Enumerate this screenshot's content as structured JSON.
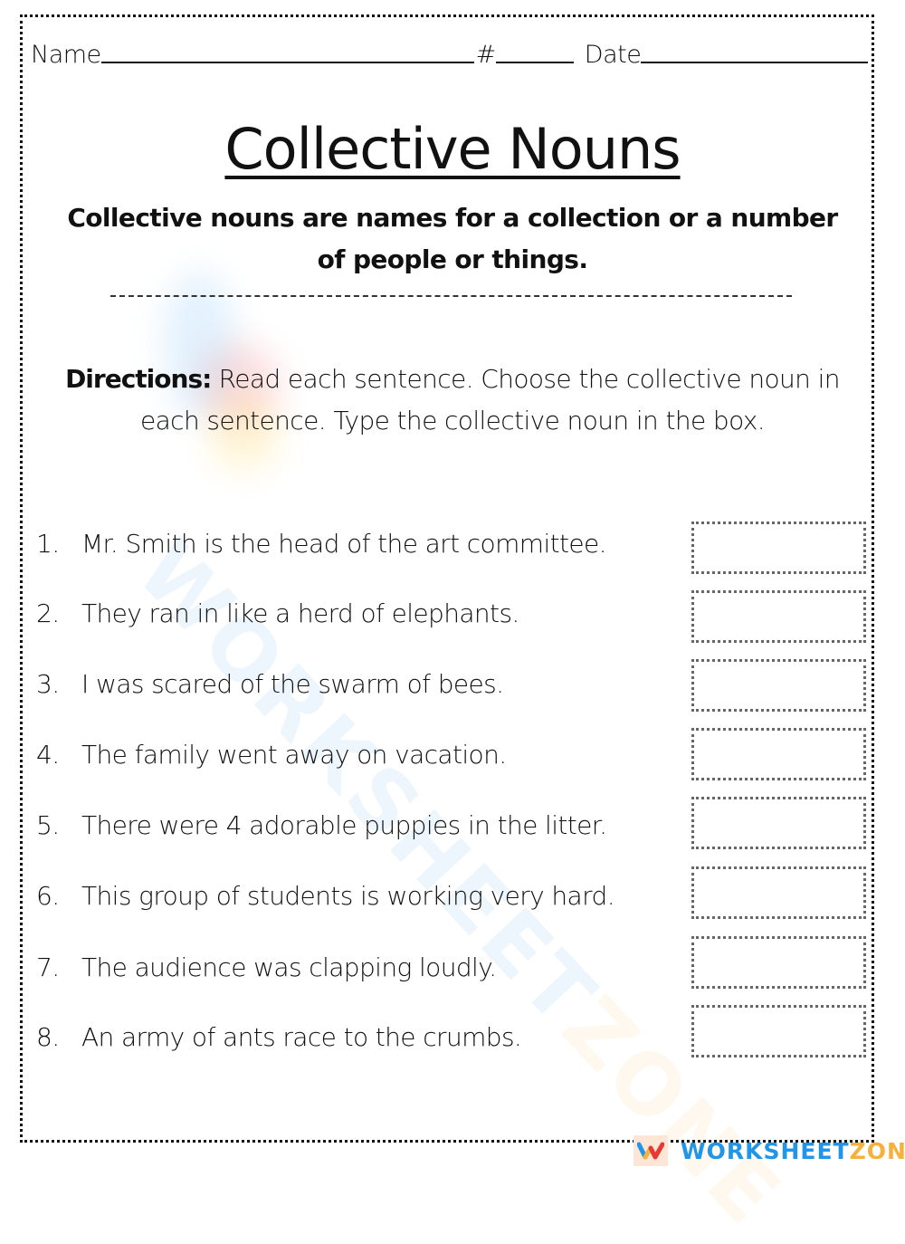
{
  "header": {
    "name_label": "Name",
    "number_label": "#",
    "date_label": "Date"
  },
  "title": "Collective Nouns",
  "definition": "Collective nouns are names for a collection or a number of people or things.",
  "directions": {
    "label": "Directions:",
    "text": " Read each sentence. Choose the collective noun in each sentence. Type the collective noun in the box."
  },
  "questions": [
    {
      "number": "1.",
      "sentence": "Mr. Smith is the head of the art committee.",
      "answer": ""
    },
    {
      "number": "2.",
      "sentence": "They ran in like a herd of elephants.",
      "answer": ""
    },
    {
      "number": "3.",
      "sentence": "I was scared of the swarm of bees.",
      "answer": ""
    },
    {
      "number": "4.",
      "sentence": "The family went away on vacation.",
      "answer": ""
    },
    {
      "number": "5.",
      "sentence": "There were 4 adorable puppies in the litter.",
      "answer": ""
    },
    {
      "number": "6.",
      "sentence": "This group of students is working very hard.",
      "answer": ""
    },
    {
      "number": "7.",
      "sentence": "The audience was clapping loudly.",
      "answer": ""
    },
    {
      "number": "8.",
      "sentence": "An army of ants race to the crumbs.",
      "answer": ""
    }
  ],
  "watermark": {
    "part1": "WORKSHEET",
    "part2": "ZONE"
  },
  "footer": {
    "logo_icon": "worksheetzone-w-logo",
    "brand_part1": "WORKSHEET",
    "brand_part2": "ZONE",
    "colors": {
      "blue": "#2196e8",
      "orange": "#f6b13c",
      "red": "#e53935"
    }
  }
}
